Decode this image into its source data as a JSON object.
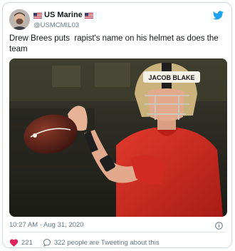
{
  "tweet": {
    "display_name": "US Marine",
    "handle": "@USMCMIL03",
    "text": "Drew Brees puts  rapist's name on his helmet as does the team",
    "timestamp": "10:27 AM · Aug 31, 2020",
    "likes": "221",
    "conversation": "322 people are Tweeting about this",
    "helmet_text": "JACOB BLAKE"
  },
  "colors": {
    "twitter_blue": "#1da1f2",
    "like_red": "#e0245e",
    "jersey_red": "#d12a23",
    "helmet_gold": "#c9b27c"
  },
  "icons": {
    "brand": "twitter-bird-icon",
    "info": "info-icon",
    "like": "heart-icon",
    "reply": "speech-bubble-icon",
    "flag": "us-flag-icon"
  }
}
